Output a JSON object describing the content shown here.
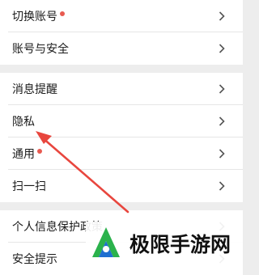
{
  "group1": [
    {
      "label": "切换账号",
      "dot": true
    },
    {
      "label": "账号与安全",
      "dot": false
    }
  ],
  "group2": [
    {
      "label": "消息提醒",
      "dot": false
    },
    {
      "label": "隐私",
      "dot": false
    },
    {
      "label": "通用",
      "dot": true
    },
    {
      "label": "扫一扫",
      "dot": false
    }
  ],
  "group3": [
    {
      "label": "个人信息保护政策",
      "dot": false
    },
    {
      "label": "安全提示",
      "dot": false
    }
  ],
  "watermark": {
    "text": "极限手游网"
  },
  "colors": {
    "dot": "#e85a50",
    "arrow": "#e8463e",
    "logo_green": "#2bb24c",
    "logo_blue": "#1f6fd0"
  },
  "icons": {
    "chevron": "chevron-right-icon",
    "arrow": "annotation-arrow",
    "logo": "watermark-logo"
  }
}
